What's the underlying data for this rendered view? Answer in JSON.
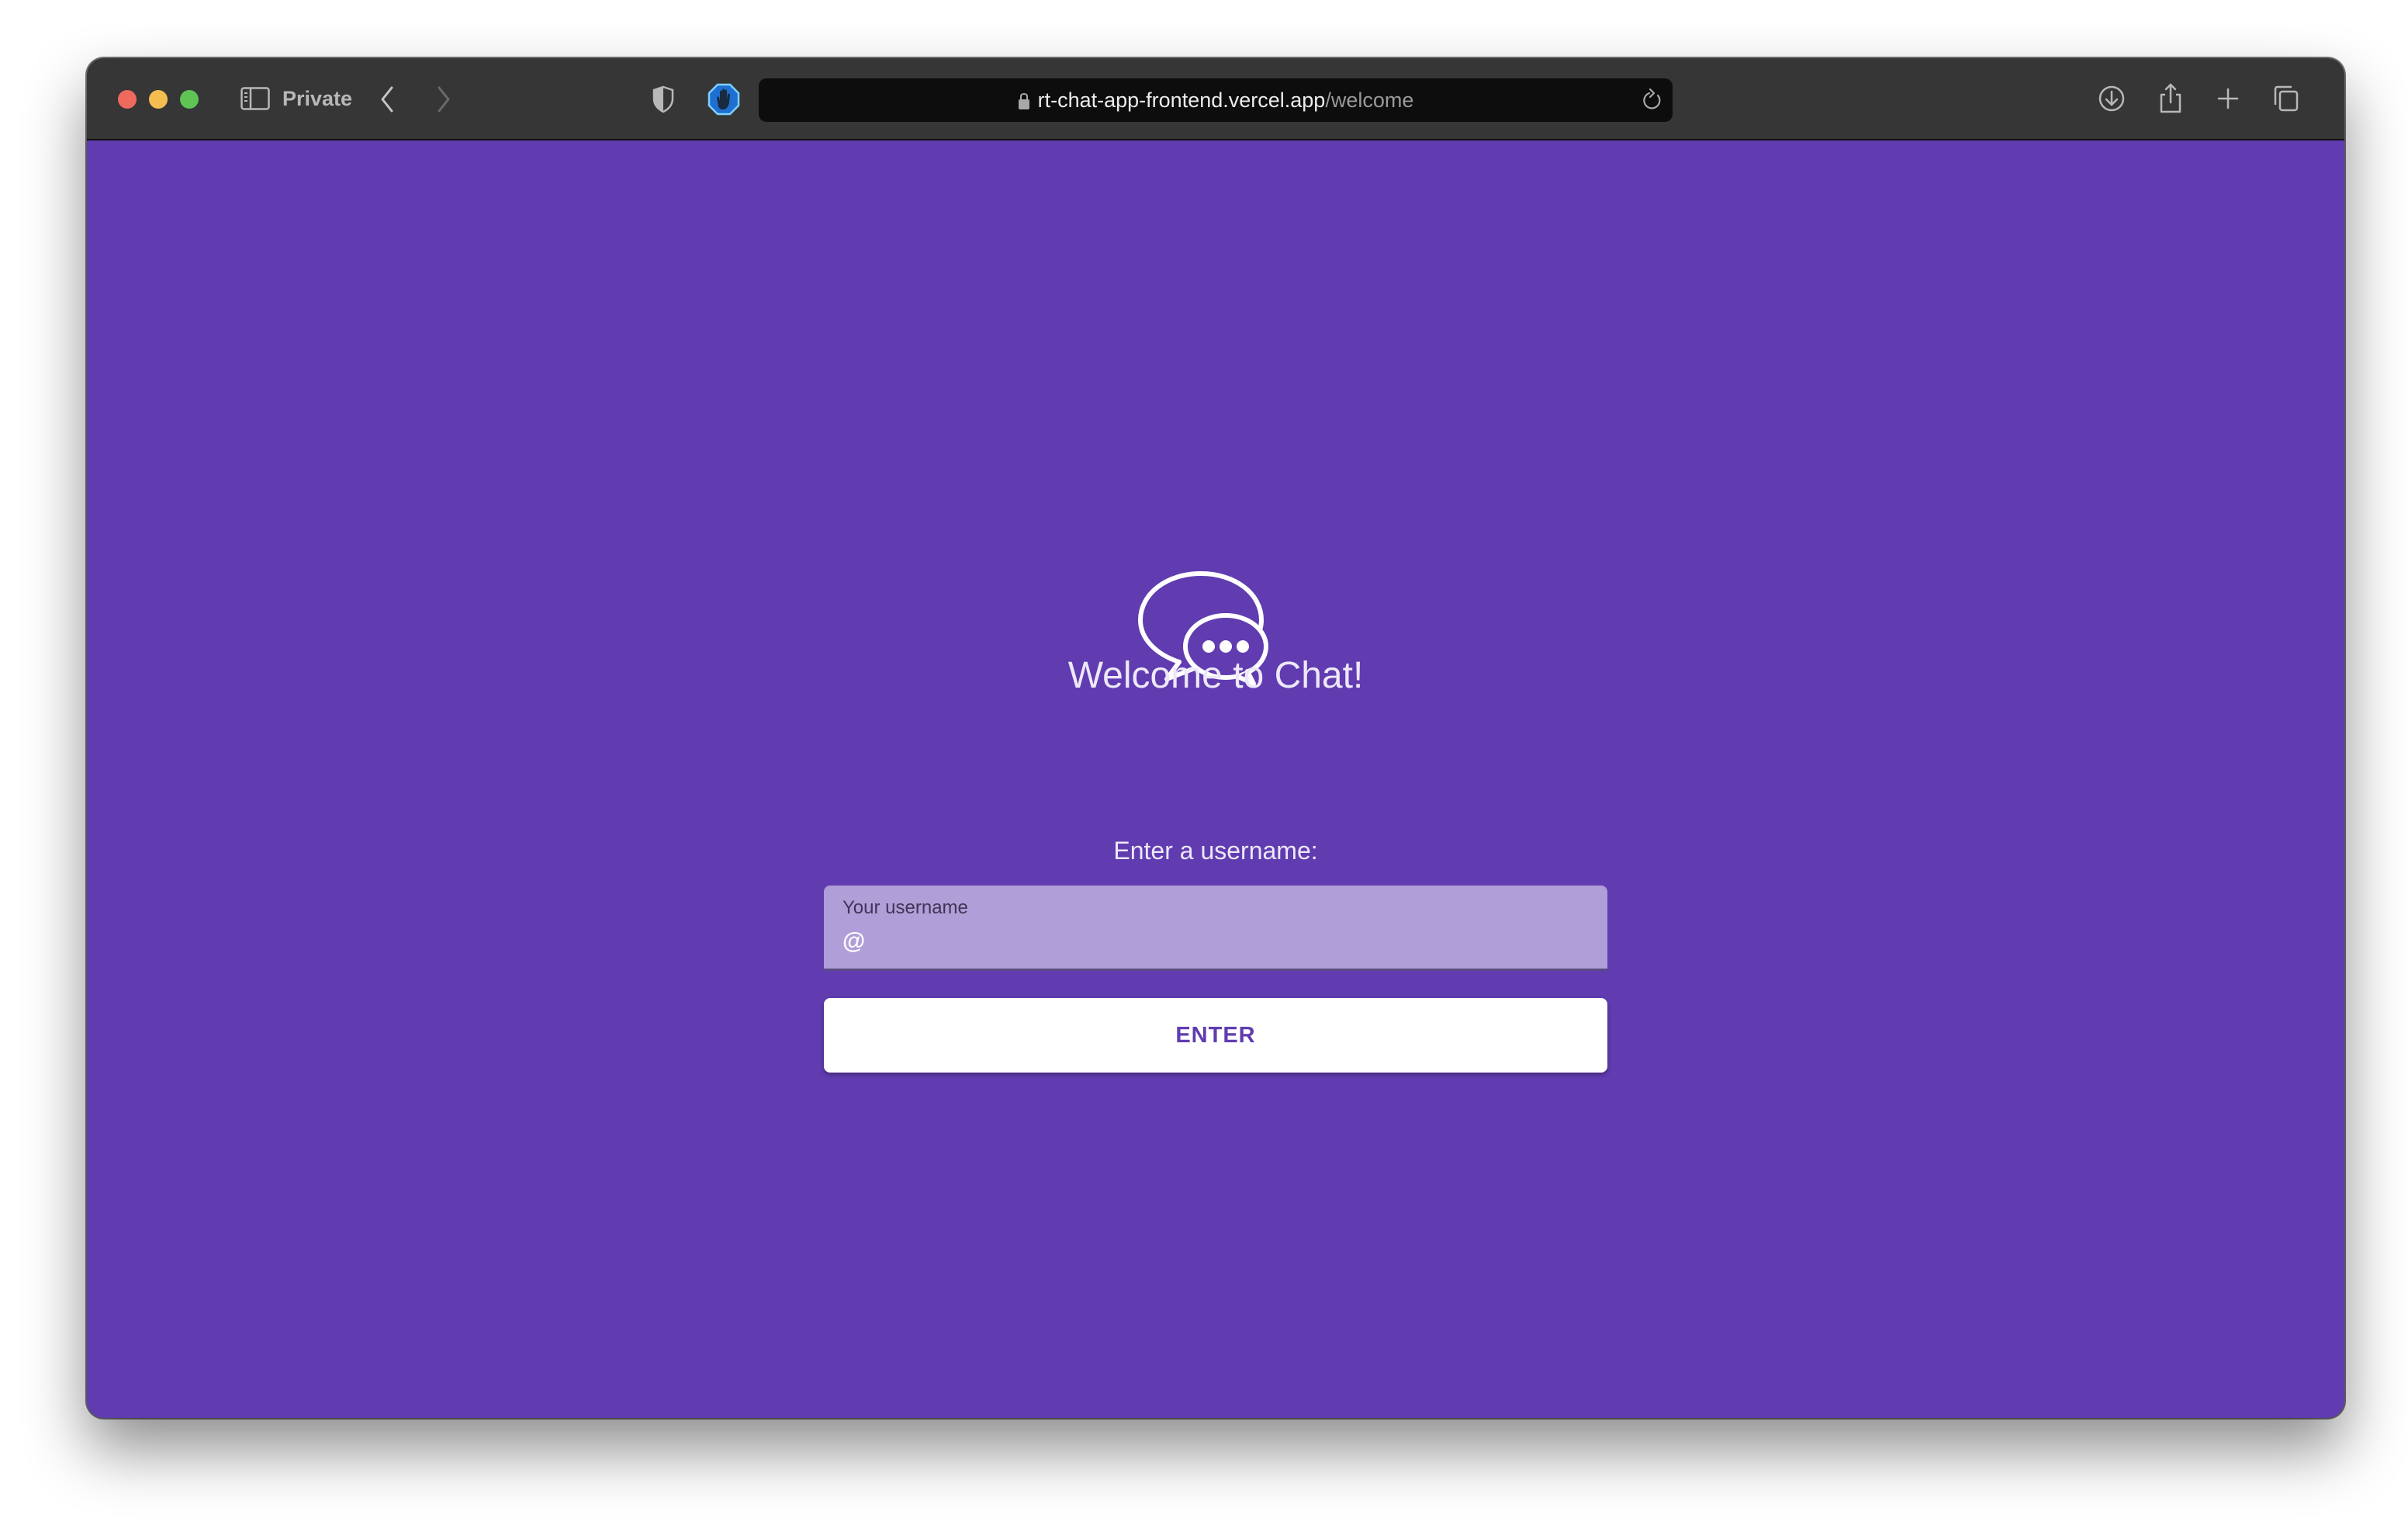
{
  "browser": {
    "mode_label": "Private",
    "url": {
      "host": "rt-chat-app-frontend.vercel.app",
      "path": "/welcome"
    },
    "icons": {
      "sidebar": "sidebar-icon",
      "back": "chevron-left-icon",
      "forward": "chevron-right-icon",
      "privacy": "shield-icon",
      "extension": "adblock-hand-icon",
      "lock": "lock-icon",
      "reload": "reload-icon",
      "download": "download-icon",
      "share": "share-icon",
      "new_tab": "plus-icon",
      "tab_overview": "tabs-icon"
    }
  },
  "page": {
    "logo_icon": "chat-bubbles-icon",
    "title": "Welcome to Chat!",
    "prompt": "Enter a username:",
    "username_field": {
      "label": "Your username",
      "value": "@",
      "placeholder": ""
    },
    "enter_button_label": "ENTER",
    "colors": {
      "background": "#603cb0",
      "field_background": "#b09ed8",
      "button_background": "#ffffff",
      "button_text": "#603cb0"
    }
  }
}
